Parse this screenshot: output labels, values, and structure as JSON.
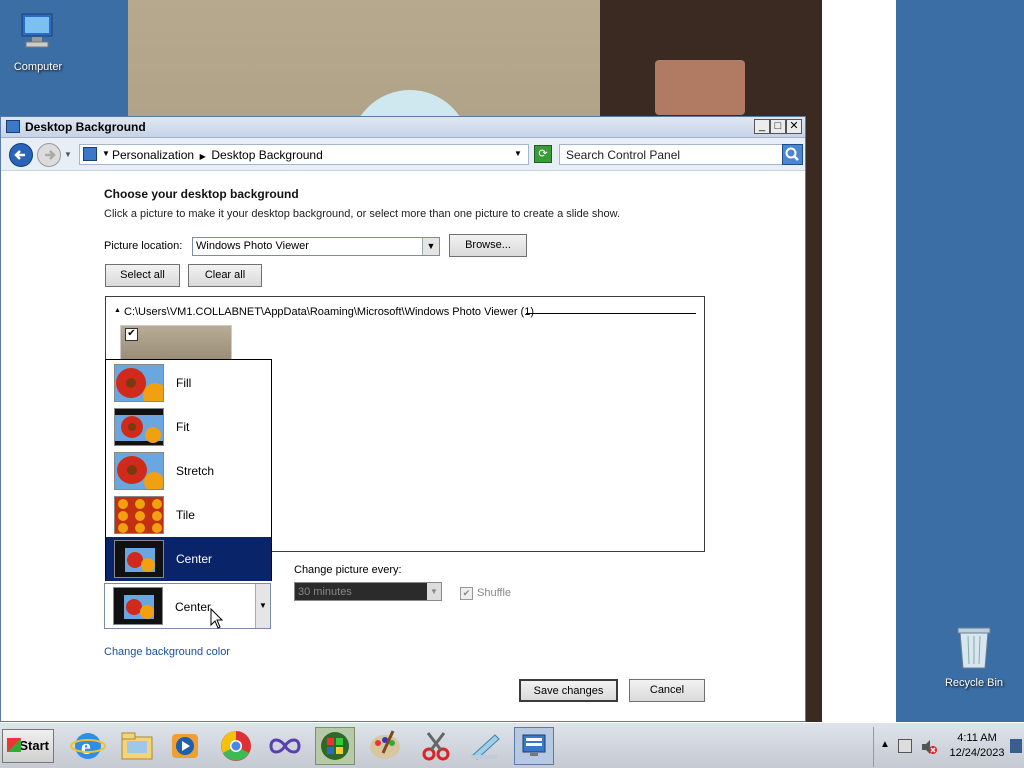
{
  "desktop": {
    "icons": [
      {
        "name": "computer",
        "label": "Computer"
      },
      {
        "name": "recycle-bin",
        "label": "Recycle Bin"
      }
    ]
  },
  "window": {
    "title": "Desktop Background",
    "controls": {
      "minimize": "_",
      "maximize": "□",
      "close": "✕"
    },
    "nav": {
      "breadcrumb": [
        "Personalization",
        "Desktop Background"
      ],
      "search_placeholder": "Search Control Panel"
    },
    "content": {
      "heading": "Choose your desktop background",
      "subtext": "Click a picture to make it your desktop background, or select more than one picture to create a slide show.",
      "picture_location_label": "Picture location:",
      "picture_location_value": "Windows Photo Viewer",
      "browse_label": "Browse...",
      "select_all_label": "Select all",
      "clear_all_label": "Clear all",
      "folder_path": "C:\\Users\\VM1.COLLABNET\\AppData\\Roaming\\Microsoft\\Windows Photo Viewer (1)",
      "picture_position_value": "Center",
      "picture_position_options": [
        "Fill",
        "Fit",
        "Stretch",
        "Tile",
        "Center"
      ],
      "picture_position_selected": "Center",
      "change_picture_label": "Change picture every:",
      "change_picture_value": "30 minutes",
      "shuffle_label": "Shuffle",
      "change_bg_color_link": "Change background color",
      "save_label": "Save changes",
      "cancel_label": "Cancel"
    }
  },
  "taskbar": {
    "start_label": "Start",
    "apps": [
      "internet-explorer-icon",
      "windows-explorer-icon",
      "media-player-icon",
      "chrome-icon",
      "infinity-icon",
      "windows-icon",
      "paint-icon",
      "snipping-tool-icon",
      "notepad-icon",
      "control-panel-icon"
    ],
    "clock_time": "4:11 AM",
    "clock_date": "12/24/2023"
  },
  "colors": {
    "desktop_blue": "#3b6ea5",
    "selection": "#0a246a"
  }
}
